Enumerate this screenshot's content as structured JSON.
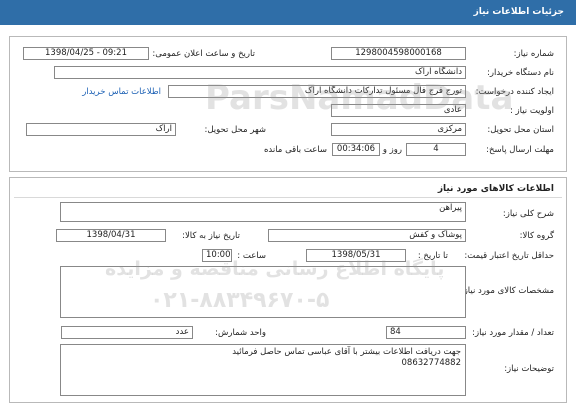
{
  "header": {
    "title": "جزئیات اطلاعات نیاز"
  },
  "need": {
    "need_number_label": "شماره نیاز:",
    "need_number": "1298004598000168",
    "announce_label": "تاریخ و ساعت اعلان عمومی:",
    "announce_value": "1398/04/25 - 09:21",
    "buyer_label": "نام دستگاه خریدار:",
    "buyer_value": "دانشگاه اراک",
    "creator_label": "ایجاد کننده درخواست:",
    "creator_value": "تورج فرج فال مسئول تدارکات دانشگاه اراک",
    "contact_link": "اطلاعات تماس خریدار",
    "priority_label": "اولویت نیاز :",
    "priority_value": "عادی",
    "province_label": "استان محل تحویل:",
    "province_value": "مرکزی",
    "city_label": "شهر محل تحویل:",
    "city_value": "اراک",
    "deadline_label": "مهلت ارسال پاسخ:",
    "deadline_days": "4",
    "days_word": "روز و",
    "deadline_time": "00:34:06",
    "remaining_word": "ساعت باقی مانده"
  },
  "goods": {
    "title": "اطلاعات کالاهای مورد نیاز",
    "summary_label": "شرح کلی نیاز:",
    "summary_value": "پیراهن",
    "group_label": "گروه کالا:",
    "group_value": "پوشاک و کفش",
    "need_date_label": "تاریخ نیاز به کالا:",
    "need_date_value": "1398/04/31",
    "validity_label": "حداقل تاریخ اعتبار قیمت:",
    "until_label": "تا تاریخ :",
    "validity_date": "1398/05/31",
    "hour_label": "ساعت :",
    "validity_time": "10:00",
    "specs_label": "مشخصات کالای مورد نیاز:",
    "qty_label": "تعداد / مقدار مورد نیاز:",
    "qty_value": "84",
    "unit_label": "واحد شمارش:",
    "unit_value": "عدد",
    "desc_label": "توضیحات نیاز:",
    "desc_line1": "جهت دریافت اطلاعات بیشتر با آقای عباسی تماس حاصل فرمائید",
    "desc_line2": "08632774882"
  },
  "watermark": {
    "line1": "ParsNamadData",
    "line2": "پایگاه اطلاع رسانی مناقصه و مزایده",
    "line3": "۰۲۱-۸۸۳۴۹۶۷۰-۵"
  }
}
